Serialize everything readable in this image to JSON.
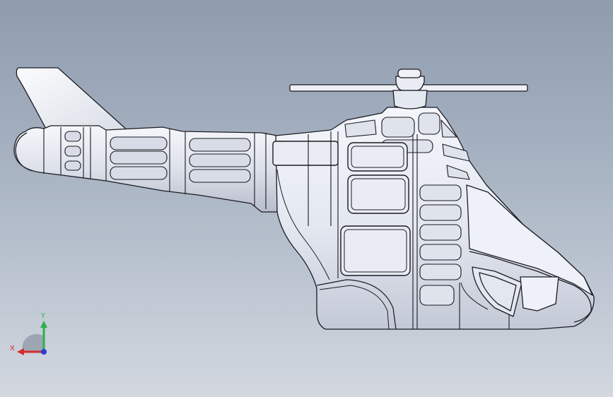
{
  "viewport": {
    "background_top": "#8f9cae",
    "background_bottom": "#d3d8e0"
  },
  "model": {
    "body_color": "#e6e9f2",
    "edge_color": "#1b1b22",
    "shade_color": "#b9bfcc"
  },
  "triad": {
    "x_label": "X",
    "y_label": "Y",
    "x_color": "#d42a2a",
    "y_color": "#2bb04a",
    "z_color": "#2a3cd4"
  }
}
